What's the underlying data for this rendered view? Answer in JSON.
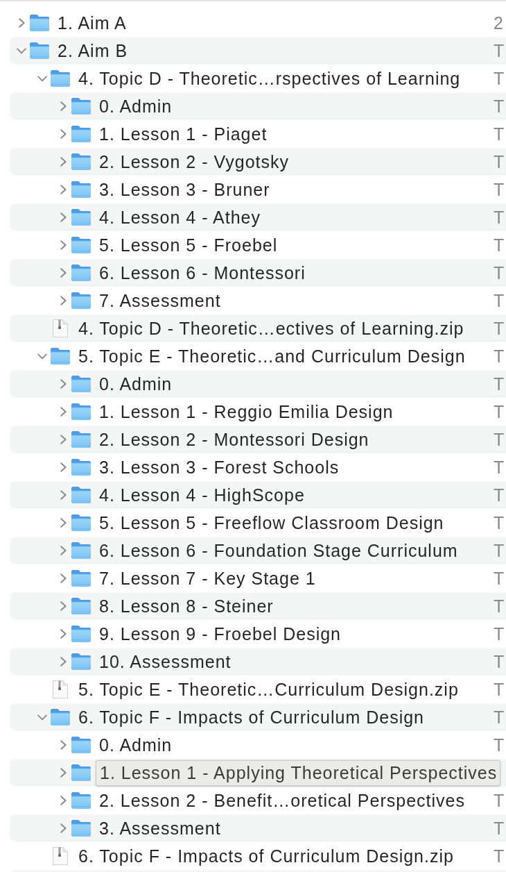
{
  "tree": {
    "items": [
      {
        "kind": "folder",
        "name": "1. Aim A",
        "expanded": false,
        "tooltip": false,
        "column_2": "2"
      },
      {
        "kind": "folder",
        "name": "2. Aim B",
        "expanded": true,
        "tooltip": false,
        "column_2": "T",
        "children": [
          {
            "kind": "folder",
            "name": "4. Topic D - Theoretic…rspectives of Learning",
            "expanded": true,
            "tooltip": false,
            "column_2": "T",
            "children": [
              {
                "kind": "folder",
                "name": "0. Admin",
                "expanded": false,
                "tooltip": false,
                "column_2": "T"
              },
              {
                "kind": "folder",
                "name": "1. Lesson 1 - Piaget",
                "expanded": false,
                "tooltip": false,
                "column_2": "T"
              },
              {
                "kind": "folder",
                "name": "2. Lesson 2 - Vygotsky",
                "expanded": false,
                "tooltip": false,
                "column_2": "T"
              },
              {
                "kind": "folder",
                "name": "3. Lesson 3 - Bruner",
                "expanded": false,
                "tooltip": false,
                "column_2": "T"
              },
              {
                "kind": "folder",
                "name": "4. Lesson 4 - Athey",
                "expanded": false,
                "tooltip": false,
                "column_2": "T"
              },
              {
                "kind": "folder",
                "name": "5. Lesson 5 - Froebel",
                "expanded": false,
                "tooltip": false,
                "column_2": "T"
              },
              {
                "kind": "folder",
                "name": "6. Lesson 6 - Montessori",
                "expanded": false,
                "tooltip": false,
                "column_2": "T"
              },
              {
                "kind": "folder",
                "name": "7. Assessment",
                "expanded": false,
                "tooltip": false,
                "column_2": "T"
              }
            ]
          },
          {
            "kind": "zip",
            "name": "4. Topic D - Theoretic…ectives of Learning.zip",
            "tooltip": false,
            "column_2": "T"
          },
          {
            "kind": "folder",
            "name": "5. Topic E - Theoretic…and Curriculum Design",
            "expanded": true,
            "tooltip": false,
            "column_2": "T",
            "children": [
              {
                "kind": "folder",
                "name": "0. Admin",
                "expanded": false,
                "tooltip": false,
                "column_2": "T"
              },
              {
                "kind": "folder",
                "name": "1. Lesson 1 - Reggio Emilia Design",
                "expanded": false,
                "tooltip": false,
                "column_2": "T"
              },
              {
                "kind": "folder",
                "name": "2. Lesson 2 - Montessori Design",
                "expanded": false,
                "tooltip": false,
                "column_2": "T"
              },
              {
                "kind": "folder",
                "name": "3. Lesson 3 - Forest Schools",
                "expanded": false,
                "tooltip": false,
                "column_2": "T"
              },
              {
                "kind": "folder",
                "name": "4. Lesson 4 - HighScope",
                "expanded": false,
                "tooltip": false,
                "column_2": "T"
              },
              {
                "kind": "folder",
                "name": "5. Lesson 5 - Freeflow Classroom Design",
                "expanded": false,
                "tooltip": false,
                "column_2": "T"
              },
              {
                "kind": "folder",
                "name": "6. Lesson 6 - Foundation Stage Curriculum",
                "expanded": false,
                "tooltip": false,
                "column_2": "T"
              },
              {
                "kind": "folder",
                "name": "7. Lesson 7 - Key Stage 1",
                "expanded": false,
                "tooltip": false,
                "column_2": "T"
              },
              {
                "kind": "folder",
                "name": "8. Lesson 8 - Steiner",
                "expanded": false,
                "tooltip": false,
                "column_2": "T"
              },
              {
                "kind": "folder",
                "name": "9. Lesson 9 - Froebel Design",
                "expanded": false,
                "tooltip": false,
                "column_2": "T"
              },
              {
                "kind": "folder",
                "name": "10. Assessment",
                "expanded": false,
                "tooltip": false,
                "column_2": "T"
              }
            ]
          },
          {
            "kind": "zip",
            "name": "5. Topic E - Theoretic…Curriculum Design.zip",
            "tooltip": false,
            "column_2": "T"
          },
          {
            "kind": "folder",
            "name": "6. Topic F - Impacts of Curriculum Design",
            "expanded": true,
            "tooltip": false,
            "column_2": "T",
            "children": [
              {
                "kind": "folder",
                "name": "0. Admin",
                "expanded": false,
                "tooltip": false,
                "column_2": "T"
              },
              {
                "kind": "folder",
                "name": "1. Lesson 1 - Applying Theoretical Perspectives",
                "expanded": false,
                "tooltip": true
              },
              {
                "kind": "folder",
                "name": "2. Lesson 2 - Benefit…oretical Perspectives",
                "expanded": false,
                "tooltip": false,
                "column_2": "T"
              },
              {
                "kind": "folder",
                "name": "3. Assessment",
                "expanded": false,
                "tooltip": false,
                "column_2": "T"
              }
            ]
          },
          {
            "kind": "zip",
            "name": "6. Topic F - Impacts of Curriculum Design.zip",
            "tooltip": false,
            "column_2": "T"
          }
        ]
      }
    ]
  }
}
